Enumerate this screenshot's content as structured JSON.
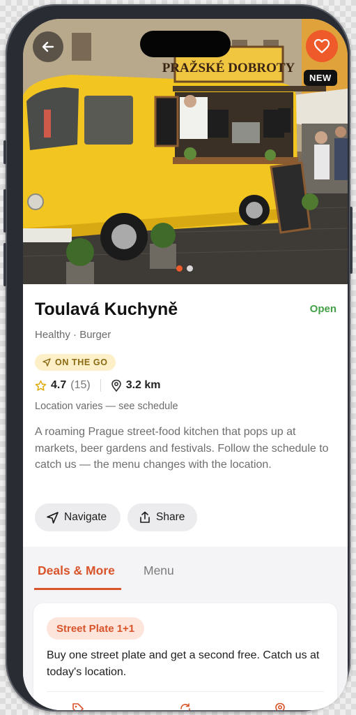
{
  "hero": {
    "sign_text": "PRAŽSKÉ DOBROTY",
    "badge": "NEW",
    "image_count": 2,
    "active_image": 1
  },
  "venue": {
    "name": "Toulavá Kuchyně",
    "status": "Open",
    "categories": "Healthy · Burger",
    "mode_badge": "ON THE GO",
    "rating": "4.7",
    "rating_count": "(15)",
    "distance": "3.2 km",
    "location_note": "Location varies — see schedule",
    "description": "A roaming Prague street-food kitchen that pops up at markets, beer gardens and festivals. Follow the schedule to catch us — the menu changes with the location."
  },
  "actions": {
    "navigate": "Navigate",
    "share": "Share"
  },
  "tabs": [
    {
      "label": "Deals & More",
      "active": true
    },
    {
      "label": "Menu",
      "active": false
    }
  ],
  "deal": {
    "title": "Street Plate 1+1",
    "description": "Buy one street plate and get a second free. Catch us at today's location.",
    "footer_icons": [
      "tag-icon",
      "repeat-icon",
      "location-pin-icon"
    ]
  },
  "colors": {
    "accent": "#ef5a2a",
    "open_status": "#43a047",
    "badge_bg": "#fdf0c8"
  }
}
